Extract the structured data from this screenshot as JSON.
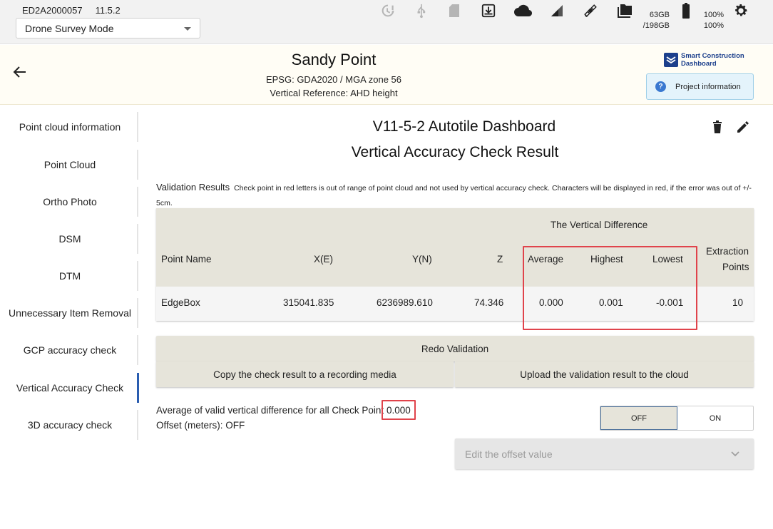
{
  "status_bar": {
    "device_id": "ED2A2000057",
    "version": "11.5.2",
    "mode": "Drone Survey Mode",
    "storage_free": "63GB",
    "storage_total": "/198GB",
    "battery_1": "100%",
    "battery_2": "100%",
    "icons": [
      "sync-icon",
      "usb-icon",
      "sd-card-icon",
      "download-icon",
      "cloud-icon",
      "signal-icon",
      "satellite-icon",
      "folder-icon",
      "battery-icon",
      "settings-icon"
    ]
  },
  "project": {
    "name": "Sandy Point",
    "epsg": "EPSG: GDA2020 / MGA zone 56",
    "vertical_reference": "Vertical Reference: AHD height",
    "logo_line1": "Smart Construction",
    "logo_line2": "Dashboard",
    "info_button": "Project information"
  },
  "sidebar": {
    "items": [
      {
        "label": "Point cloud information",
        "active": false
      },
      {
        "label": "Point Cloud",
        "active": false
      },
      {
        "label": "Ortho Photo",
        "active": false
      },
      {
        "label": "DSM",
        "active": false
      },
      {
        "label": "DTM",
        "active": false
      },
      {
        "label": "Unnecessary Item Removal",
        "active": false
      },
      {
        "label": "GCP accuracy check",
        "active": false
      },
      {
        "label": "Vertical Accuracy Check",
        "active": true
      },
      {
        "label": "3D accuracy check",
        "active": false
      }
    ]
  },
  "main": {
    "dashboard_title": "V11-5-2 Autotile Dashboard",
    "section_title": "Vertical Accuracy Check Result",
    "validation_label": "Validation Results",
    "validation_note": "Check point in red letters is out of range of point cloud and not used by vertical accuracy check. Characters will be displayed in red, if the error was out of +/- 5cm.",
    "table": {
      "group_header": "The Vertical Difference",
      "headers": {
        "point_name": "Point Name",
        "x": "X(E)",
        "y": "Y(N)",
        "z": "Z",
        "average": "Average",
        "highest": "Highest",
        "lowest": "Lowest",
        "extraction_1": "Extraction",
        "extraction_2": "Points"
      },
      "rows": [
        {
          "point_name": "EdgeBox",
          "x": "315041.835",
          "y": "6236989.610",
          "z": "74.346",
          "average": "0.000",
          "highest": "0.001",
          "lowest": "-0.001",
          "extraction": "10"
        }
      ]
    },
    "redo_button": "Redo Validation",
    "copy_button": "Copy the check result to a recording media",
    "upload_button": "Upload the validation result to the cloud",
    "average_label": "Average of valid vertical difference for all Check Point",
    "average_value": "0.000",
    "offset_label": "Offset (meters): OFF",
    "toggle_off": "OFF",
    "toggle_on": "ON",
    "offset_placeholder": "Edit the offset value"
  },
  "colors": {
    "highlight_box": "#e0434b",
    "accent": "#2a5db0",
    "table_bg": "#e6e4da"
  }
}
